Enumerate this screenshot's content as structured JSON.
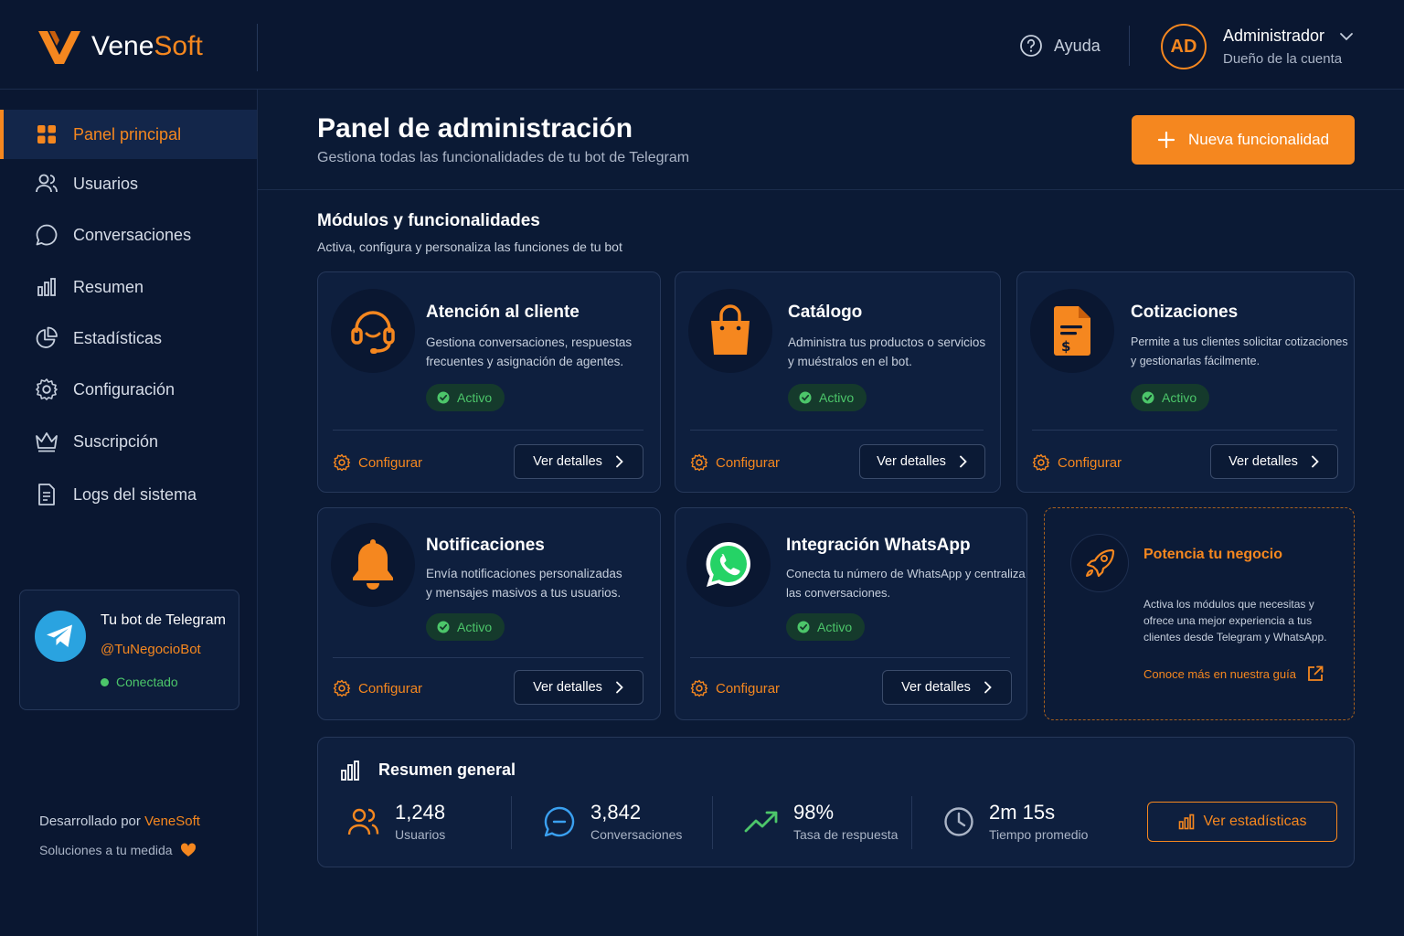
{
  "brand": {
    "name_part1": "Vene",
    "name_part2": "Soft"
  },
  "header": {
    "help_label": "Ayuda",
    "avatar_initials": "AD",
    "user_name": "Administrador",
    "user_role": "Dueño de la cuenta"
  },
  "sidebar": {
    "items": [
      {
        "label": "Panel principal",
        "icon": "grid-icon",
        "active": true
      },
      {
        "label": "Usuarios",
        "icon": "users-icon"
      },
      {
        "label": "Conversaciones",
        "icon": "chat-bubble-icon"
      },
      {
        "label": "Resumen",
        "icon": "bar-chart-icon"
      },
      {
        "label": "Estadísticas",
        "icon": "pie-chart-icon"
      },
      {
        "label": "Configuración",
        "icon": "gear-icon"
      },
      {
        "label": "Suscripción",
        "icon": "crown-icon"
      },
      {
        "label": "Logs del sistema",
        "icon": "document-icon"
      }
    ],
    "telegram": {
      "title": "Tu bot de Telegram",
      "handle": "@TuNegocioBot",
      "status": "Conectado"
    },
    "footer": {
      "developed_by": "Desarrollado por",
      "developer": "VeneSoft",
      "tagline": "Soluciones a tu medida"
    }
  },
  "page": {
    "title": "Panel de administración",
    "subtitle": "Gestiona todas las funcionalidades de tu bot de Telegram",
    "new_button": "Nueva funcionalidad"
  },
  "modules_section": {
    "title": "Módulos y funcionalidades",
    "subtitle": "Activa, configura y personaliza las funciones de tu bot",
    "config_label": "Configurar",
    "details_label": "Ver detalles",
    "cards": [
      {
        "title": "Atención al cliente",
        "desc1": "Gestiona conversaciones, respuestas",
        "desc2": "frecuentes y asignación de agentes.",
        "status": "Activo",
        "icon": "headset-icon"
      },
      {
        "title": "Catálogo",
        "desc1": "Administra tus productos o servicios",
        "desc2": "y muéstralos en el bot.",
        "status": "Activo",
        "icon": "shopping-bag-icon"
      },
      {
        "title": "Cotizaciones",
        "desc1": "Permite a tus clientes solicitar cotizaciones",
        "desc2": "y gestionarlas fácilmente.",
        "status": "Activo",
        "icon": "invoice-icon"
      },
      {
        "title": "Notificaciones",
        "desc1": "Envía notificaciones personalizadas",
        "desc2": "y mensajes masivos a tus usuarios.",
        "status": "Activo",
        "icon": "bell-icon"
      },
      {
        "title": "Integración WhatsApp",
        "desc1": "Conecta tu número de WhatsApp y centraliza",
        "desc2": "las conversaciones.",
        "status": "Activo",
        "icon": "whatsapp-icon"
      }
    ],
    "promo": {
      "title": "Potencia tu negocio",
      "text": "Activa los módulos que necesitas y ofrece una mejor experiencia a tus clientes desde Telegram y WhatsApp.",
      "link": "Conoce más en nuestra guía"
    }
  },
  "summary": {
    "title": "Resumen general",
    "stats": [
      {
        "value": "1,248",
        "label": "Usuarios",
        "icon": "users-icon"
      },
      {
        "value": "3,842",
        "label": "Conversaciones",
        "icon": "chat-bubble-icon"
      },
      {
        "value": "98%",
        "label": "Tasa de respuesta",
        "icon": "trending-up-icon"
      },
      {
        "value": "2m 15s",
        "label": "Tiempo promedio",
        "icon": "clock-icon"
      }
    ],
    "button": "Ver estadísticas"
  },
  "colors": {
    "accent": "#f5871f",
    "success": "#4cc66a",
    "background": "#0b1a35",
    "telegram": "#2aa3e0",
    "whatsapp": "#25d366"
  }
}
